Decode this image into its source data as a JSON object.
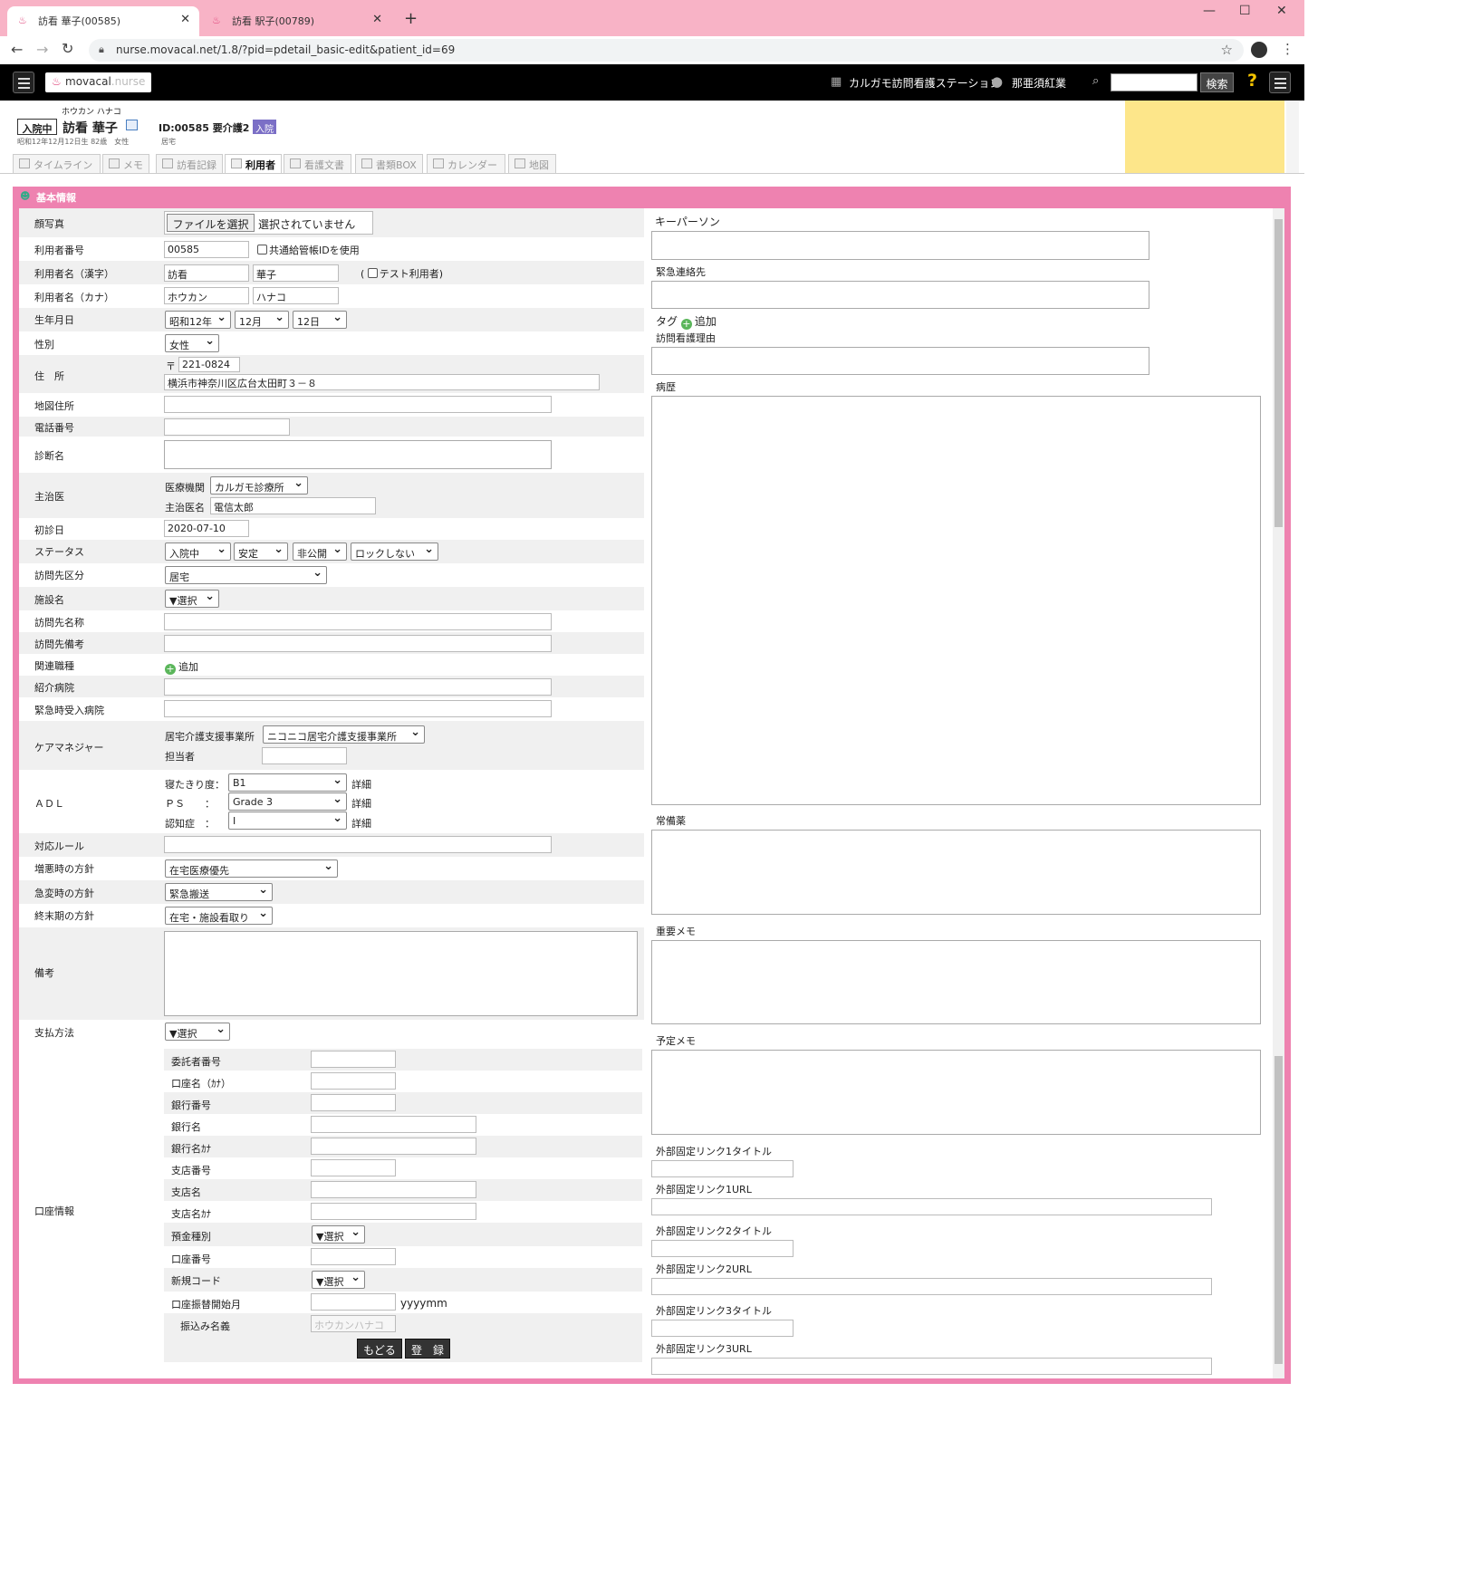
{
  "browser": {
    "tabs": [
      {
        "title": "訪看 華子(00585)",
        "active": true
      },
      {
        "title": "訪看 駅子(00789)",
        "active": false
      }
    ],
    "new_tab": "+",
    "url": "nurse.movacal.net/1.8/?pid=pdetail_basic-edit&patient_id=69",
    "window_controls": [
      "—",
      "☐",
      "✕"
    ]
  },
  "appbar": {
    "logo_brand": "movacal",
    "logo_suffix": ".nurse",
    "station": "カルガモ訪問看護ステーション",
    "user": "那亜須紅業",
    "search_value": "",
    "search_button": "検索",
    "help": "?"
  },
  "patient": {
    "status_badge": "入院中",
    "kana": "ホウカン ハナコ",
    "name": "訪看 華子",
    "id_text": "ID:00585 要介護2",
    "admit_badge": "入院",
    "dob_line": "昭和12年12月12日生 82歳　女性",
    "residence": "居宅"
  },
  "patient_tabs": [
    {
      "label": "タイムライン",
      "active": false
    },
    {
      "label": "メモ",
      "active": false
    },
    {
      "label": "訪看記録",
      "active": false
    },
    {
      "label": "利用者",
      "active": true
    },
    {
      "label": "看護文書",
      "active": false
    },
    {
      "label": "書類BOX",
      "active": false
    },
    {
      "label": "カレンダー",
      "active": false
    },
    {
      "label": "地図",
      "active": false
    }
  ],
  "section_title": "基本情報",
  "form": {
    "photo": {
      "label": "顔写真",
      "button": "ファイルを選択",
      "status": "選択されていません"
    },
    "user_number": {
      "label": "利用者番号",
      "value": "00585",
      "checkbox": "共通給管帳IDを使用"
    },
    "name_kanji": {
      "label": "利用者名（漢字）",
      "last": "訪看",
      "first": "華子",
      "test_open": "(",
      "test_label": "テスト利用者)"
    },
    "name_kana": {
      "label": "利用者名（カナ）",
      "last": "ホウカン",
      "first": "ハナコ"
    },
    "dob": {
      "label": "生年月日",
      "year": "昭和12年",
      "month": "12月",
      "day": "12日"
    },
    "sex": {
      "label": "性別",
      "value": "女性"
    },
    "address": {
      "label": "住　所",
      "zip_mark": "〒",
      "zip": "221-0824",
      "line": "横浜市神奈川区広台太田町３－８"
    },
    "map_address": {
      "label": "地図住所",
      "value": ""
    },
    "phone": {
      "label": "電話番号",
      "value": ""
    },
    "diagnosis": {
      "label": "診断名"
    },
    "physician": {
      "label": "主治医",
      "inst_label": "医療機関",
      "inst_value": "カルガモ診療所",
      "doc_label": "主治医名",
      "doc_value": "電信太郎"
    },
    "first_visit": {
      "label": "初診日",
      "value": "2020-07-10"
    },
    "status": {
      "label": "ステータス",
      "v1": "入院中",
      "v2": "安定",
      "v3": "非公開",
      "v4": "ロックしない"
    },
    "visit_category": {
      "label": "訪問先区分",
      "value": "居宅"
    },
    "facility": {
      "label": "施設名",
      "value": "▼選択"
    },
    "visit_name": {
      "label": "訪問先名称",
      "value": ""
    },
    "visit_note": {
      "label": "訪問先備考",
      "value": ""
    },
    "related": {
      "label": "関連職種",
      "add": "追加"
    },
    "referral": {
      "label": "紹介病院",
      "value": ""
    },
    "emergency_hospital": {
      "label": "緊急時受入病院",
      "value": ""
    },
    "care_manager": {
      "label": "ケアマネジャー",
      "office_label": "居宅介護支援事業所",
      "office_value": "ニコニコ居宅介護支援事業所",
      "person_label": "担当者",
      "person_value": ""
    },
    "adl": {
      "label": "ＡＤＬ",
      "bedridden_label": "寝たきり度：",
      "bedridden": "B1",
      "ps_label": "ＰＳ　　：",
      "ps": "Grade 3",
      "dementia_label": "認知症　：",
      "dementia": "Ⅰ",
      "detail": "詳細"
    },
    "rule": {
      "label": "対応ルール",
      "value": ""
    },
    "worsen": {
      "label": "増悪時の方針",
      "value": "在宅医療優先"
    },
    "sudden": {
      "label": "急変時の方針",
      "value": "緊急搬送"
    },
    "terminal": {
      "label": "終末期の方針",
      "value": "在宅・施設看取り"
    },
    "remarks": {
      "label": "備考"
    },
    "payment": {
      "label": "支払方法",
      "value": "▼選択"
    },
    "bank": {
      "label": "口座情報",
      "consignor": "委託者番号",
      "account_name_kana": "口座名（ｶﾅ）",
      "bank_no": "銀行番号",
      "bank_name": "銀行名",
      "bank_name_kana": "銀行名ｶﾅ",
      "branch_no": "支店番号",
      "branch_name": "支店名",
      "branch_name_kana": "支店名ｶﾅ",
      "deposit_type": "預金種別",
      "deposit_value": "▼選択",
      "account_no": "口座番号",
      "new_code": "新規コード",
      "new_code_value": "▼選択",
      "start_month": "口座振替開始月",
      "yyyymm": "yyyymm",
      "transfer_name": "振込み名義",
      "transfer_value": "ホウカンハナコ"
    },
    "back_button": "もどる",
    "register_button": "登　録"
  },
  "right": {
    "keyperson": "キーパーソン",
    "emergency": "緊急連絡先",
    "tag": "タグ",
    "tag_add": "追加",
    "reason": "訪問看護理由",
    "history": "病歴",
    "medicine": "常備薬",
    "important_memo": "重要メモ",
    "schedule_memo": "予定メモ",
    "link1_title": "外部固定リンク1タイトル",
    "link1_url": "外部固定リンク1URL",
    "link2_title": "外部固定リンク2タイトル",
    "link2_url": "外部固定リンク2URL",
    "link3_title": "外部固定リンク3タイトル",
    "link3_url": "外部固定リンク3URL"
  },
  "colors": {
    "tab_strip": "#f8b3c6",
    "frame": "#ee82b0",
    "appbar": "#000000",
    "yellow": "#fde68a",
    "accent_badge": "#7b6fc6"
  }
}
